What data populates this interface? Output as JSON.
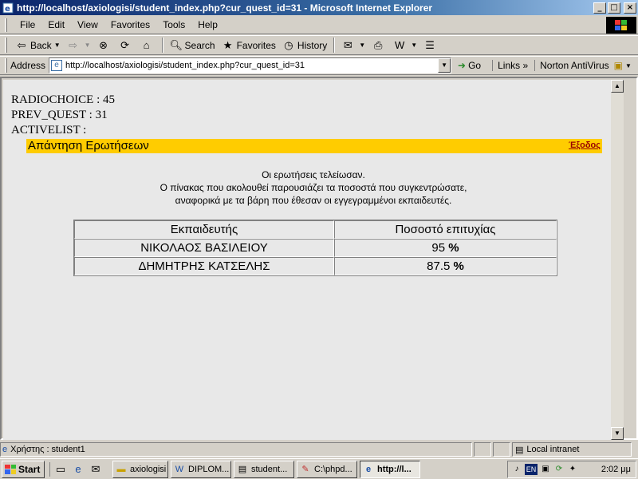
{
  "window": {
    "title": "http://localhost/axiologisi/student_index.php?cur_quest_id=31 - Microsoft Internet Explorer",
    "minimize": "_",
    "maximize": "□",
    "close": "×"
  },
  "menu": [
    "File",
    "Edit",
    "View",
    "Favorites",
    "Tools",
    "Help"
  ],
  "toolbar": {
    "back": "Back",
    "search": "Search",
    "favorites": "Favorites",
    "history": "History"
  },
  "address": {
    "label": "Address",
    "url": "http://localhost/axiologisi/student_index.php?cur_quest_id=31",
    "go": "Go",
    "links": "Links",
    "norton": "Norton AntiVirus"
  },
  "page": {
    "debug": [
      "RADIOCHOICE : 45",
      "PREV_QUEST : 31",
      "ACTIVELIST :"
    ],
    "heading": "Απάντηση Ερωτήσεων",
    "exit_link": "Έξοδος",
    "message": [
      "Οι ερωτήσεις τελείωσαν.",
      "Ο πίνακας που ακολουθεί παρουσιάζει τα ποσοστά που συγκεντρώσατε,",
      "αναφορικά με τα βάρη που έθεσαν οι εγγεγραμμένοι εκπαιδευτές."
    ],
    "table": {
      "headers": [
        "Εκπαιδευτής",
        "Ποσοστό επιτυχίας"
      ],
      "rows": [
        {
          "name": "ΝΙΚΟΛΑΟΣ ΒΑΣΙΛΕΙΟΥ",
          "score": "95",
          "unit": "%"
        },
        {
          "name": "ΔΗΜΗΤΡΗΣ ΚΑΤΣΕΛΗΣ",
          "score": "87.5",
          "unit": "%"
        }
      ]
    }
  },
  "status": {
    "user": "Χρήστης : student1",
    "zone": "Local intranet"
  },
  "taskbar": {
    "start": "Start",
    "tasks": [
      "axiologisi",
      "DIPLOM...",
      "student...",
      "C:\\phpd...",
      "http://l..."
    ],
    "lang": "EN",
    "clock": "2:02 μμ"
  }
}
